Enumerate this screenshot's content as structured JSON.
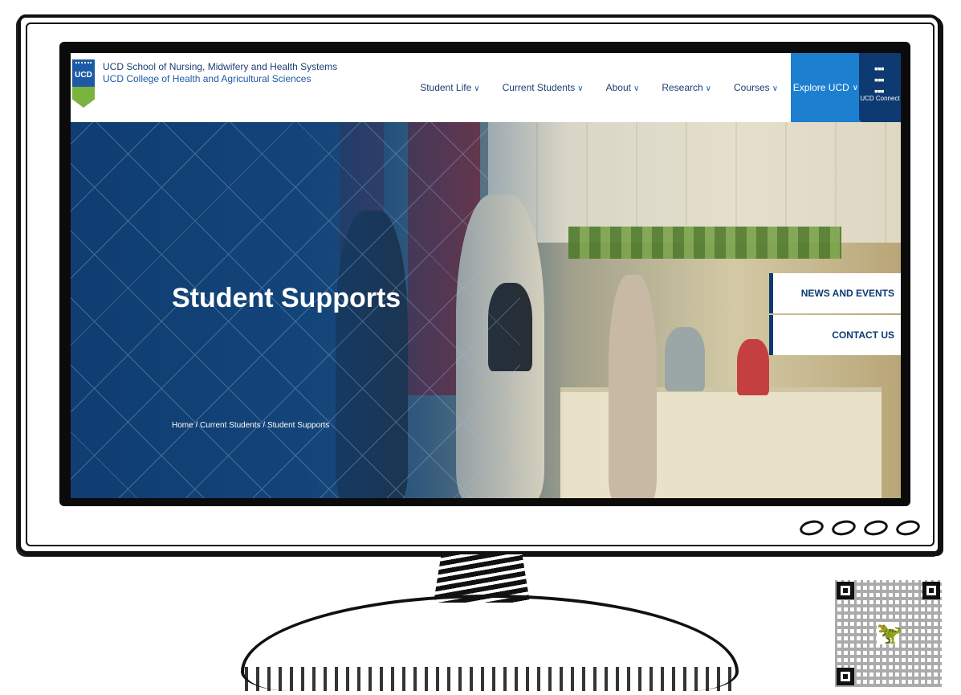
{
  "site": {
    "brand_line1": "UCD School of Nursing, Midwifery and Health Systems",
    "brand_line2": "UCD College of Health and Agricultural Sciences",
    "crest_text": "UCD"
  },
  "nav": {
    "items": [
      {
        "label": "Student Life"
      },
      {
        "label": "Current Students"
      },
      {
        "label": "About"
      },
      {
        "label": "Research"
      },
      {
        "label": "Courses"
      }
    ],
    "explore_label": "Explore UCD",
    "connect_label": "UCD Connect",
    "chevron": "∨"
  },
  "hero": {
    "title": "Student Supports",
    "breadcrumb": [
      "Home",
      "Current Students",
      "Student Supports"
    ],
    "breadcrumb_separator": "/"
  },
  "side_links": [
    {
      "label": "NEWS AND EVENTS"
    },
    {
      "label": "CONTACT US"
    }
  ],
  "icons": {
    "connect": "grid-icon",
    "chevron": "chevron-down-icon",
    "qr": "qr-code-icon"
  }
}
